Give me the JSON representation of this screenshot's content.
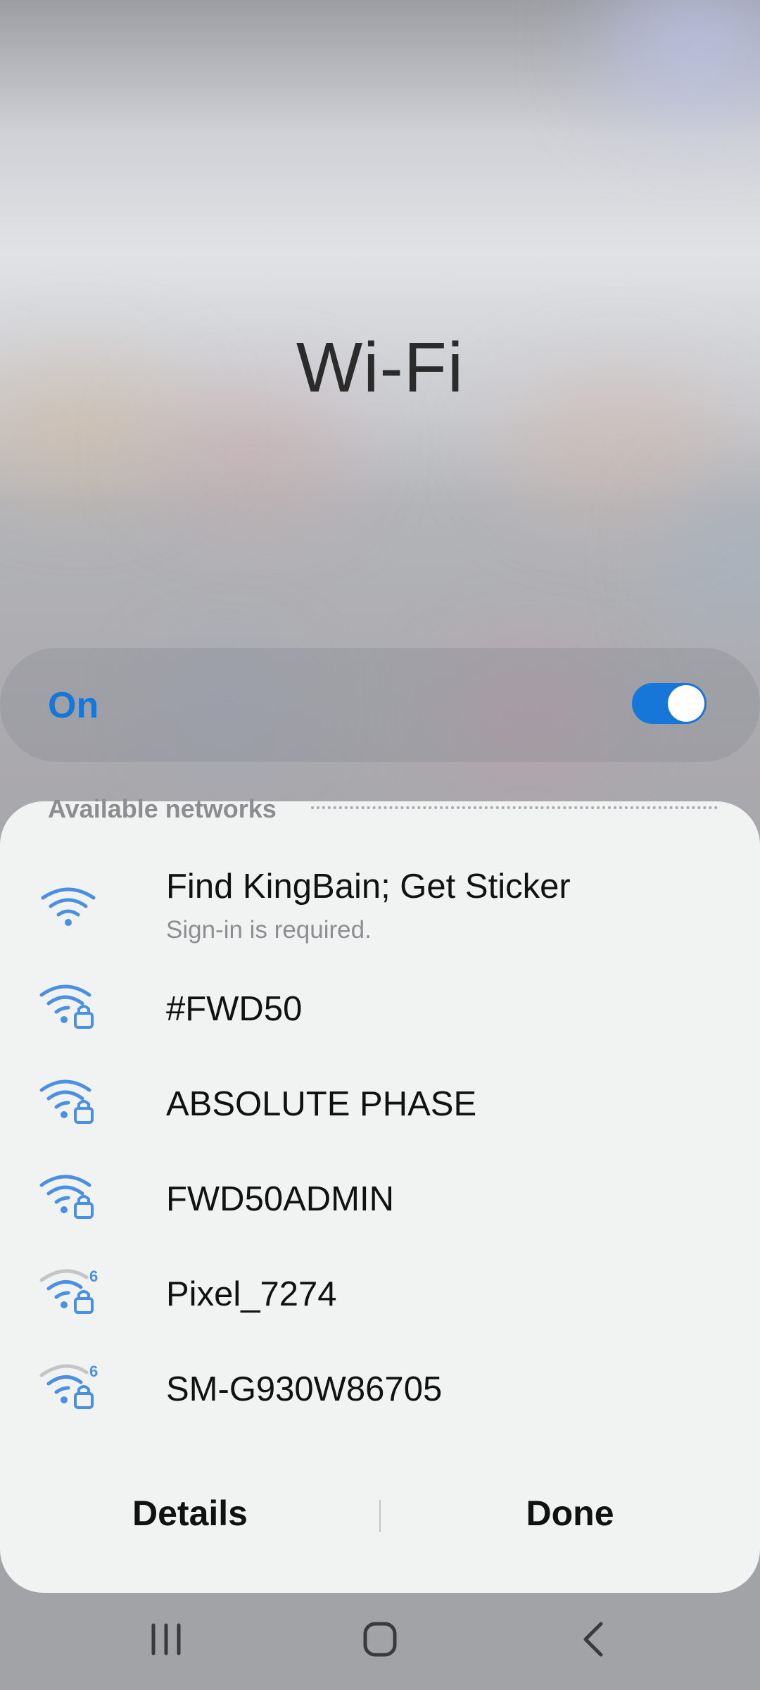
{
  "page": {
    "title": "Wi-Fi"
  },
  "toggle": {
    "label": "On",
    "enabled": true
  },
  "networks_section": {
    "header": "Available networks"
  },
  "networks": [
    {
      "name": "Find KingBain; Get Sticker",
      "subtitle": "Sign-in is required.",
      "icon": "wifi-open-icon",
      "secured": false,
      "band": ""
    },
    {
      "name": "#FWD50",
      "subtitle": "",
      "icon": "wifi-locked-icon",
      "secured": true,
      "band": ""
    },
    {
      "name": "ABSOLUTE PHASE",
      "subtitle": "",
      "icon": "wifi-locked-icon",
      "secured": true,
      "band": ""
    },
    {
      "name": "FWD50ADMIN",
      "subtitle": "",
      "icon": "wifi-locked-icon",
      "secured": true,
      "band": ""
    },
    {
      "name": "Pixel_7274",
      "subtitle": "",
      "icon": "wifi-6-locked-icon",
      "secured": true,
      "band": "6"
    },
    {
      "name": "SM-G930W86705",
      "subtitle": "",
      "icon": "wifi-6-locked-icon",
      "secured": true,
      "band": "6"
    }
  ],
  "actions": {
    "details_label": "Details",
    "done_label": "Done"
  },
  "navbar": {
    "recents_icon": "recents-icon",
    "home_icon": "home-icon",
    "back_icon": "back-icon"
  },
  "colors": {
    "accent": "#1677d9",
    "wifi_icon": "#4a90e2",
    "wifi_icon_weak": "#c4c5c8",
    "sheet": "#f1f2f2"
  }
}
